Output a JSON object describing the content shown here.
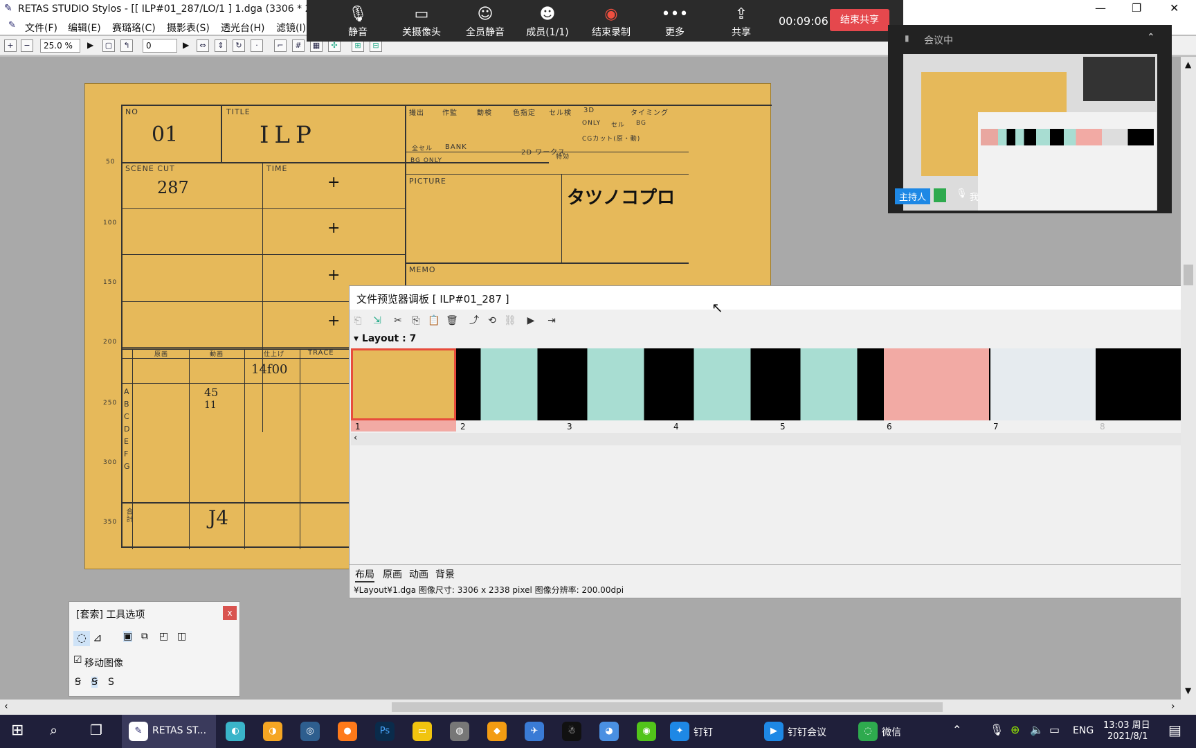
{
  "window": {
    "title": "RETAS STUDIO Stylos - [[ ILP#01_287/LO/1 ] 1.dga (3306 * 2",
    "controls": [
      "—",
      "❐",
      "✕"
    ]
  },
  "menu": [
    "文件(F)",
    "编辑(E)",
    "赛璐珞(C)",
    "摄影表(S)",
    "透光台(H)",
    "滤镜(I)"
  ],
  "toolbar": {
    "zoom": "25.0 %",
    "frame": "0"
  },
  "meeting": {
    "buttons": [
      {
        "label": "静音",
        "icon": "mic-icon"
      },
      {
        "label": "关摄像头",
        "icon": "camera-icon"
      },
      {
        "label": "全员静音",
        "icon": "mute-all-icon"
      },
      {
        "label": "成员(1/1)",
        "icon": "members-icon"
      },
      {
        "label": "结束录制",
        "icon": "record-icon"
      },
      {
        "label": "更多",
        "icon": "more-icon"
      },
      {
        "label": "共享",
        "icon": "share-icon"
      }
    ],
    "timer": "00:09:06",
    "end_share": "结束共享"
  },
  "conference": {
    "title": "会议中",
    "host": "主持人",
    "me": "我"
  },
  "sheet": {
    "no_label": "NO",
    "no_value": "01",
    "title_label": "TITLE",
    "title_value": "ILP",
    "scene_label": "SCENE CUT",
    "scene_value": "287",
    "time_label": "TIME",
    "picture_label": "PICTURE",
    "memo_label": "MEMO",
    "trace_label": "TRACE",
    "bank": "BANK",
    "bg_only": "BG ONLY",
    "only": "ONLY",
    "cel": "セル",
    "bg": "BG",
    "three_d": "3D",
    "two_d": "2D ワークス",
    "cg_cut": "CGカット(原・動)",
    "all_cel": "全セル",
    "special": "特効",
    "brand": "タツノコプロ",
    "rows": [
      "A",
      "B",
      "C",
      "D",
      "E",
      "F",
      "G"
    ],
    "headers": [
      "原画",
      "動画",
      "仕上げ"
    ],
    "total_label": "合計",
    "row_ab_values": [
      "45",
      "11"
    ],
    "cell_value": "14f00",
    "total_value": "J4",
    "top_headers": [
      "撮出",
      "作監",
      "動検",
      "色指定",
      "セル検",
      "タイミング"
    ],
    "ruler": [
      "50",
      "100",
      "150",
      "200",
      "250",
      "300",
      "350"
    ]
  },
  "browser": {
    "title": "文件预览器调板 [ ILP#01_287 ]",
    "layout_label": "Layout : 7",
    "frames": [
      "1",
      "2",
      "3",
      "4",
      "5",
      "6",
      "7",
      "8"
    ],
    "tabs": [
      "布局",
      "原画",
      "动画",
      "背景"
    ],
    "status": "¥Layout¥1.dga  图像尺寸: 3306 x 2338 pixel  图像分辨率: 200.00dpi"
  },
  "tooloption": {
    "title": "[套索] 工具选项",
    "move_image": "移动图像",
    "close": "x"
  },
  "taskbar": {
    "apps": [
      {
        "label": "RETAS ST...",
        "color": "#3a3a5c"
      },
      {
        "label": "钉钉",
        "color": "#1e88e5"
      },
      {
        "label": "钉钉会议",
        "color": "#1e88e5"
      },
      {
        "label": "微信",
        "color": "#2eaa4e"
      }
    ],
    "lang": "ENG",
    "time": "13:03 周日",
    "date": "2021/8/1"
  }
}
